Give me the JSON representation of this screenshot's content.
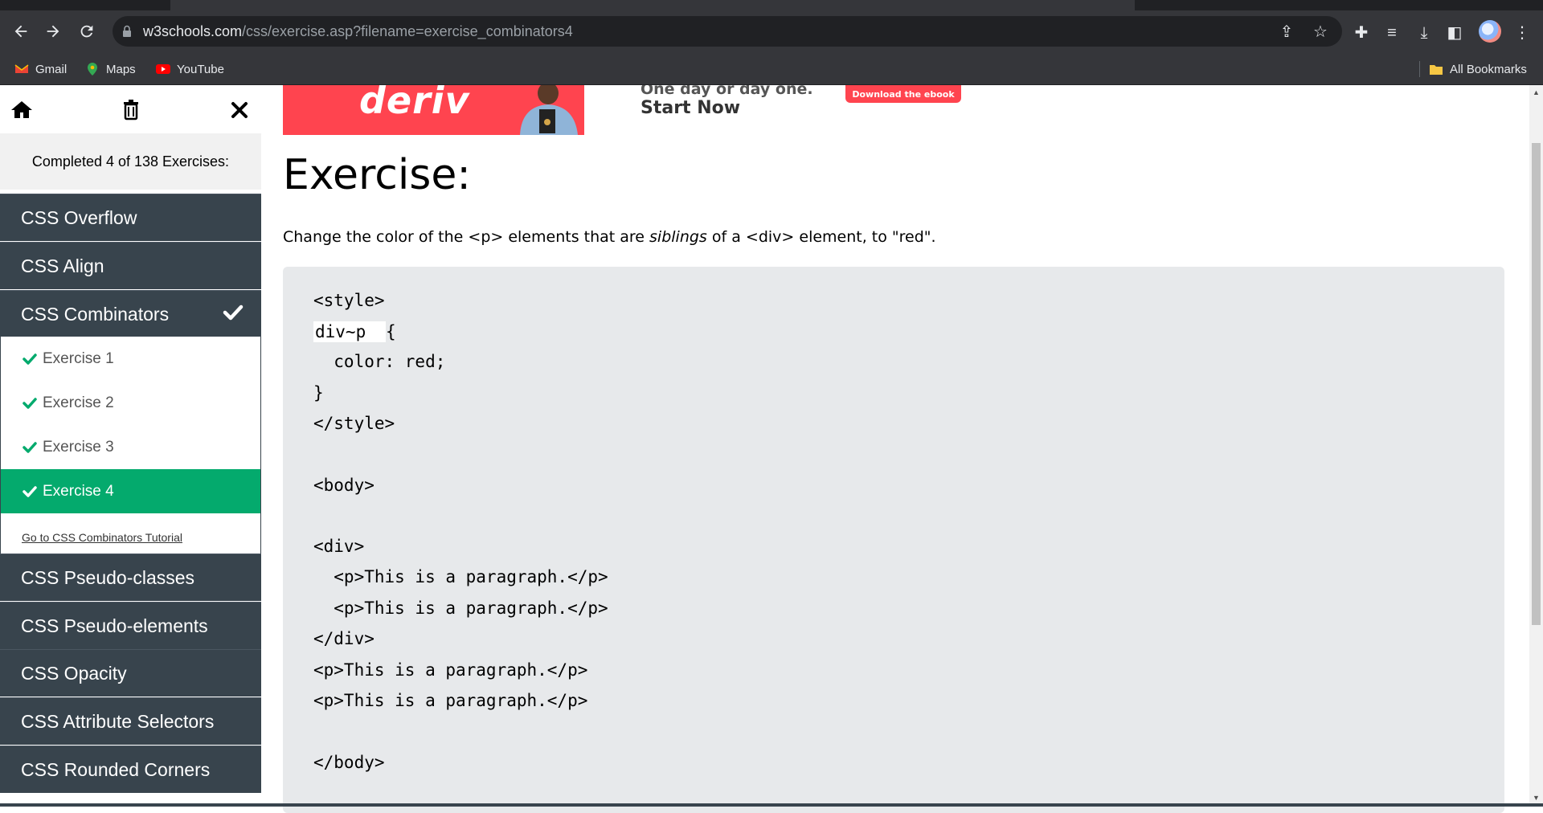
{
  "browser": {
    "url_host": "w3schools.com",
    "url_path": "/css/exercise.asp?filename=exercise_combinators4",
    "bookmarks": [
      {
        "label": "Gmail",
        "icon": "gmail-icon"
      },
      {
        "label": "Maps",
        "icon": "maps-icon"
      },
      {
        "label": "YouTube",
        "icon": "youtube-icon"
      }
    ],
    "all_bookmarks": "All Bookmarks"
  },
  "sidebar": {
    "completed_text": "Completed 4 of 138 Exercises:",
    "topics_before": [
      "CSS Overflow",
      "CSS Align"
    ],
    "current_topic": "CSS Combinators",
    "exercises": [
      {
        "label": "Exercise 1",
        "done": true
      },
      {
        "label": "Exercise 2",
        "done": true
      },
      {
        "label": "Exercise 3",
        "done": true
      },
      {
        "label": "Exercise 4",
        "done": true,
        "active": true
      }
    ],
    "tutorial_link": "Go to CSS Combinators Tutorial",
    "topics_after": [
      "CSS Pseudo-classes",
      "CSS Pseudo-elements",
      "CSS Opacity",
      "CSS Attribute Selectors",
      "CSS Rounded Corners"
    ]
  },
  "ad": {
    "logo": "deriv",
    "tagline": "One day or day one.",
    "cta": "Start Now",
    "button": "Download the ebook",
    "brand_color": "#ff444f"
  },
  "exercise": {
    "title": "Exercise:",
    "desc_before": "Change the color of the <p> elements that are ",
    "desc_emph": "siblings",
    "desc_after": " of a <div> element, to \"red\".",
    "answer_value": "div~p",
    "code_lines": [
      "<style>",
      "{",
      "  color: red;",
      "}",
      "</style>",
      "<body>",
      "<div>",
      "  <p>This is a paragraph.</p>",
      "  <p>This is a paragraph.</p>",
      "</div>",
      "<p>This is a paragraph.</p>",
      "<p>This is a paragraph.</p>",
      "</body>"
    ]
  },
  "colors": {
    "sidebar_dark": "#38444d",
    "accent_green": "#04aa6d",
    "code_bg": "#e7e9eb"
  }
}
